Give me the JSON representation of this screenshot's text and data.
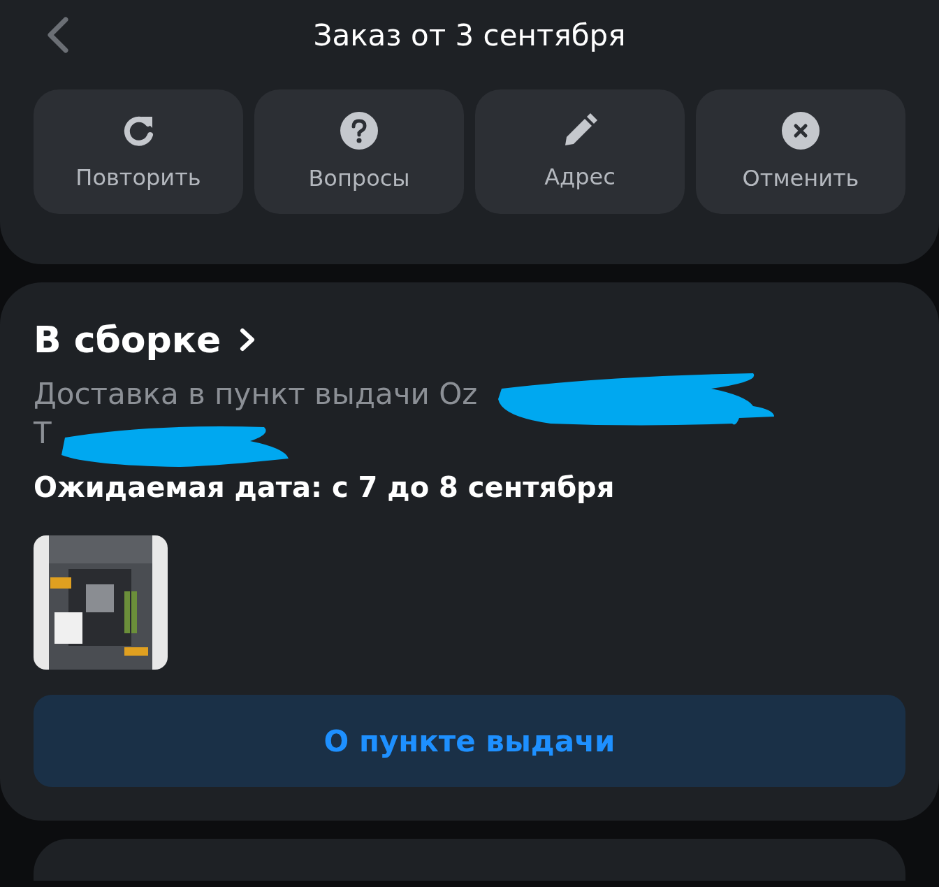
{
  "header": {
    "title": "Заказ от 3 сентября"
  },
  "actions": [
    {
      "kind": "repeat",
      "label": "Повторить"
    },
    {
      "kind": "question",
      "label": "Вопросы"
    },
    {
      "kind": "edit",
      "label": "Адрес"
    },
    {
      "kind": "cancel",
      "label": "Отменить"
    }
  ],
  "order": {
    "status": "В сборке",
    "delivery_lines": [
      "Доставка в пункт выдачи Oz",
      "Т"
    ],
    "expected_date": "Ожидаемая дата: с 7 до 8 сентября",
    "button": "О пункте выдачи"
  }
}
